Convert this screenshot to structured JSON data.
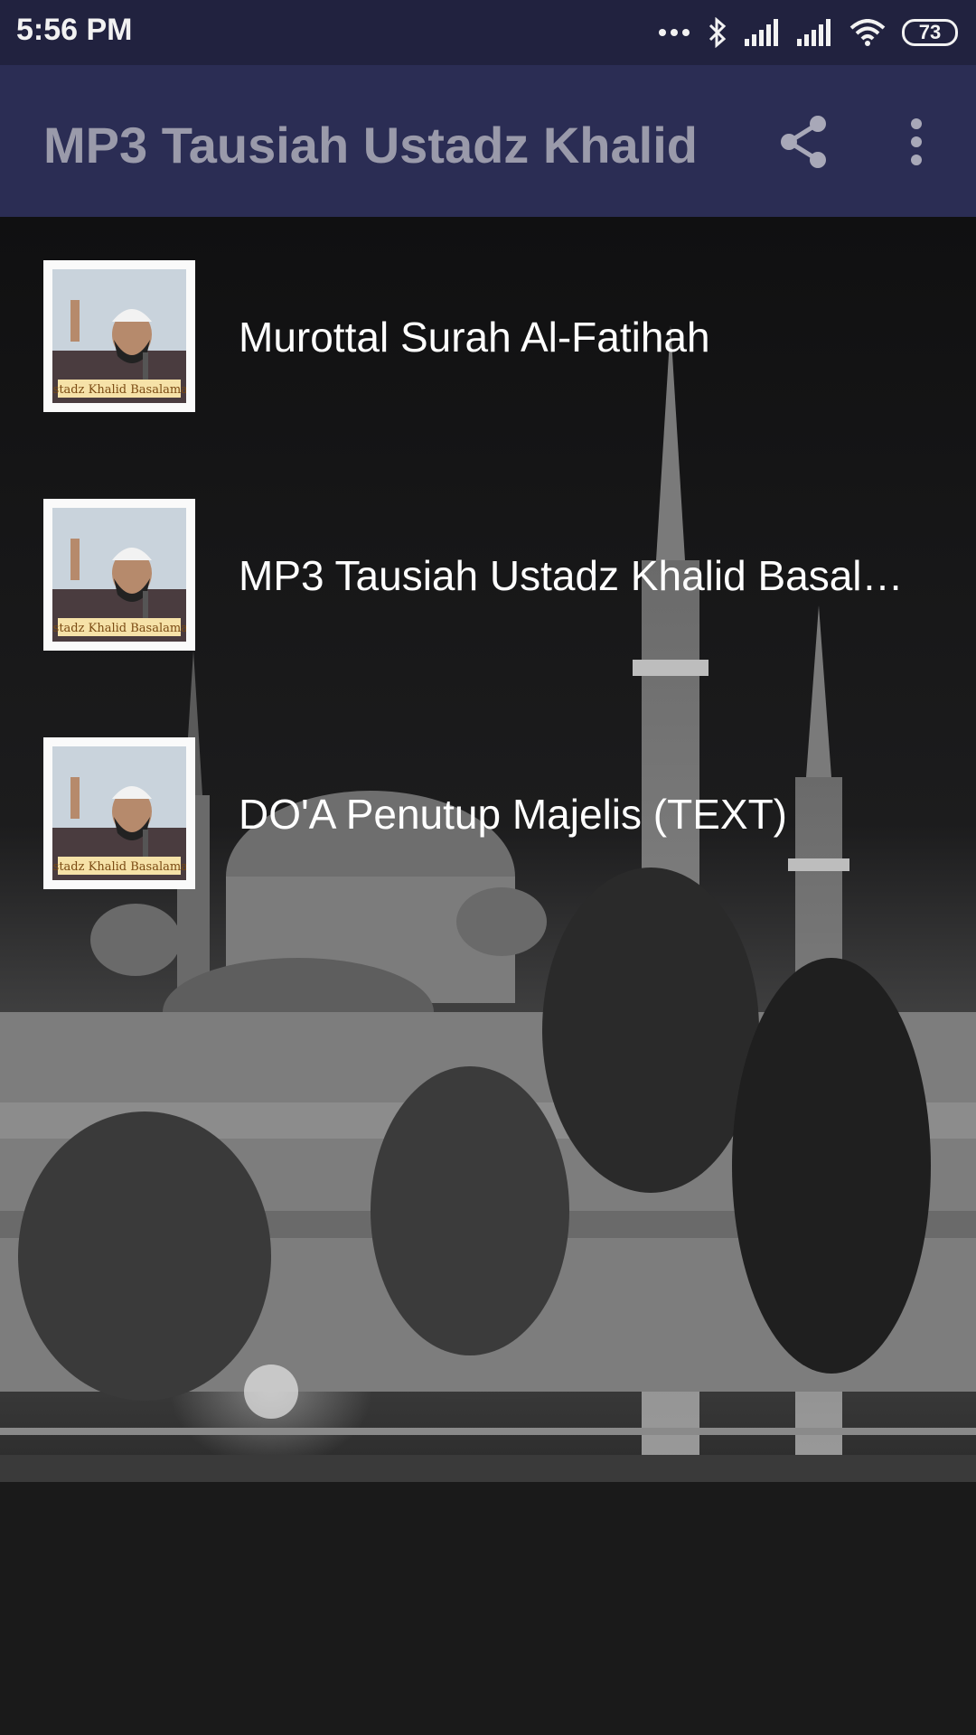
{
  "status_bar": {
    "time": "5:56 PM",
    "battery_level": "73",
    "icons": [
      "more-dots-icon",
      "bluetooth-icon",
      "signal-icon",
      "signal-icon",
      "wifi-icon",
      "battery-icon"
    ]
  },
  "app_bar": {
    "title": "MP3 Tausiah Ustadz Khalid",
    "actions": [
      "share-icon",
      "overflow-menu-icon"
    ]
  },
  "list": {
    "items": [
      {
        "label": "Murottal Surah Al-Fatihah",
        "thumbnail_caption": "Ustadz Khalid Basalamah"
      },
      {
        "label": "MP3 Tausiah Ustadz Khalid Basal…",
        "thumbnail_caption": "Ustadz Khalid Basalamah"
      },
      {
        "label": "DO'A Penutup Majelis (TEXT)",
        "thumbnail_caption": "Ustadz Khalid Basalamah"
      }
    ]
  },
  "colors": {
    "status_bar": "#21223f",
    "app_bar": "#2b2d54",
    "title_text": "#9a9aaa",
    "item_text": "#ffffff"
  }
}
